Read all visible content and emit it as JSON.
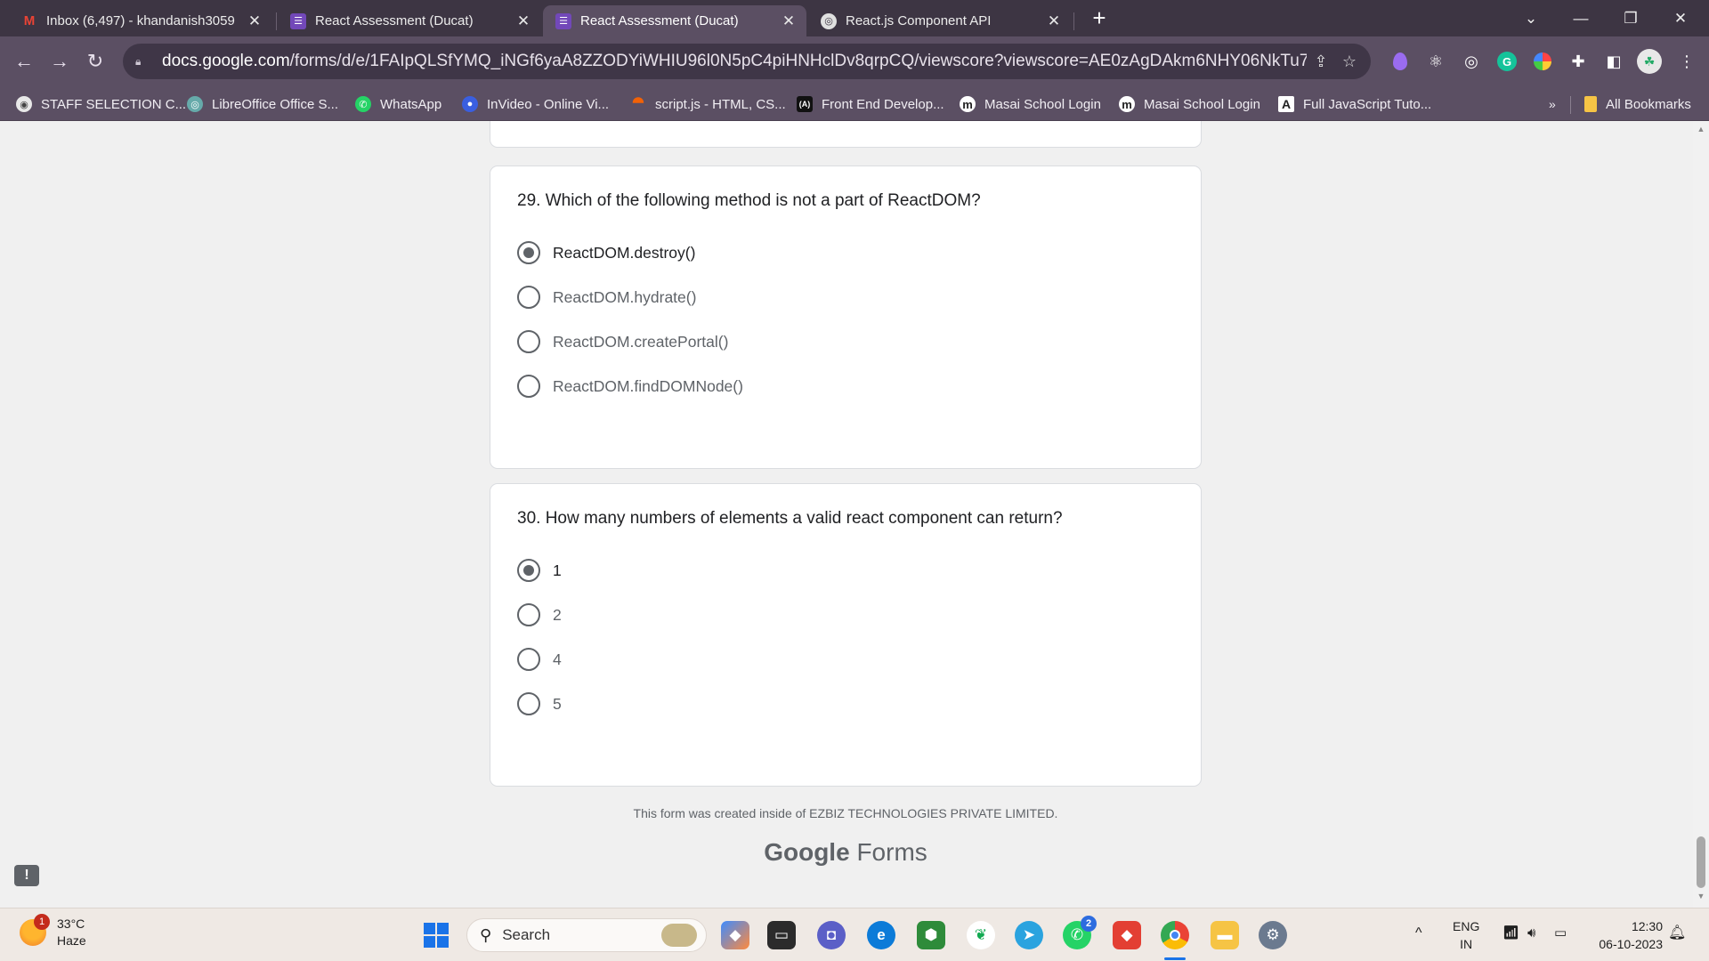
{
  "tabs": [
    {
      "label": "Inbox (6,497) - khandanish3059",
      "icon": "gmail-icon",
      "active": false
    },
    {
      "label": "React Assessment (Ducat)",
      "icon": "google-forms-icon",
      "active": false
    },
    {
      "label": "React Assessment (Ducat)",
      "icon": "google-forms-icon",
      "active": true
    },
    {
      "label": "React.js Component API",
      "icon": "chatgpt-icon",
      "active": false
    }
  ],
  "toolbar": {
    "url_domain": "docs.google.com",
    "url_path": "/forms/d/e/1FAIpQLSfYMQ_iNGf6yaA8ZZODYiWHIU96l0N5pC4piHNHclDv8qrpCQ/viewscore?viewscore=AE0zAgDAkm6NHY06NkTu78Pcj_UY3QjW..."
  },
  "bookmarks": [
    {
      "label": "STAFF SELECTION C...",
      "icon": "chrome-icon"
    },
    {
      "label": "LibreOffice Office S...",
      "icon": "chatgpt-icon"
    },
    {
      "label": "WhatsApp",
      "icon": "whatsapp-icon"
    },
    {
      "label": "InVideo - Online Vi...",
      "icon": "invideo-icon"
    },
    {
      "label": "script.js - HTML, CS...",
      "icon": "replit-icon"
    },
    {
      "label": "Front End Develop...",
      "icon": "frontend-icon"
    },
    {
      "label": "Masai School Login",
      "icon": "masai-icon"
    },
    {
      "label": "Masai School Login",
      "icon": "masai-icon"
    },
    {
      "label": "Full JavaScript Tuto...",
      "icon": "a-icon"
    }
  ],
  "bookmarks_more": "»",
  "all_bookmarks": "All Bookmarks",
  "form": {
    "questions": [
      {
        "text": "29. Which of the following method is not a part of ReactDOM?",
        "options": [
          "ReactDOM.destroy()",
          "ReactDOM.hydrate()",
          "ReactDOM.createPortal()",
          "ReactDOM.findDOMNode()"
        ],
        "selected_index": 0
      },
      {
        "text": "30. How many numbers of elements a valid react component can return?",
        "options": [
          "1",
          "2",
          "4",
          "5"
        ],
        "selected_index": 0
      }
    ],
    "footer_note": "This form was created inside of EZBIZ TECHNOLOGIES PRIVATE LIMITED.",
    "brand_google": "Google",
    "brand_forms": "Forms"
  },
  "taskbar": {
    "weather_temp": "33°C",
    "weather_desc": "Haze",
    "weather_badge": "1",
    "search_placeholder": "Search",
    "whatsapp_badge": "2",
    "lang_line1": "ENG",
    "lang_line2": "IN",
    "time": "12:30",
    "date": "06-10-2023"
  },
  "colors": {
    "tab_strip": "#3d3543",
    "toolbar": "#5b4f63",
    "page_bg": "#f0f0f0",
    "radio": "#5f6368"
  }
}
